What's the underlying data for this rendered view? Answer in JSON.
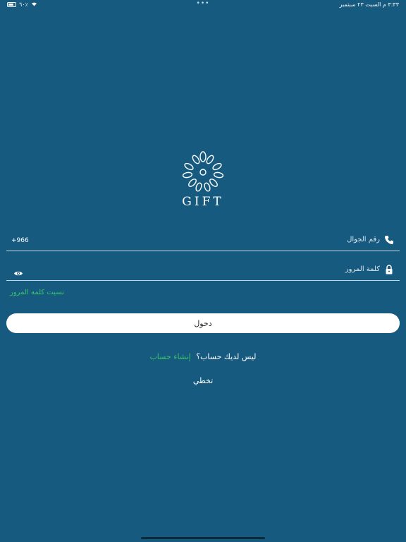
{
  "status_bar": {
    "time": "٣:٣٣ م  السبت ٢٣ سبتمبر",
    "battery": "٦٠٪",
    "dots": "•••"
  },
  "logo": {
    "text": "GIFT"
  },
  "phone_field": {
    "label": "رقم الجوال",
    "country_code": "+966",
    "icon": "phone-icon"
  },
  "password_field": {
    "label": "كلمة المرور",
    "icon": "lock-icon",
    "visibility_icon": "eye-icon"
  },
  "forgot_password": "نسيت كلمة المرور",
  "login_button": "دخول",
  "signup": {
    "text": "ليس لديك حساب؟",
    "link": "إنشاء حساب"
  },
  "skip": "تخطي",
  "colors": {
    "background": "#175a80",
    "accent_green": "#39c56a",
    "button_bg": "#ffffff"
  }
}
